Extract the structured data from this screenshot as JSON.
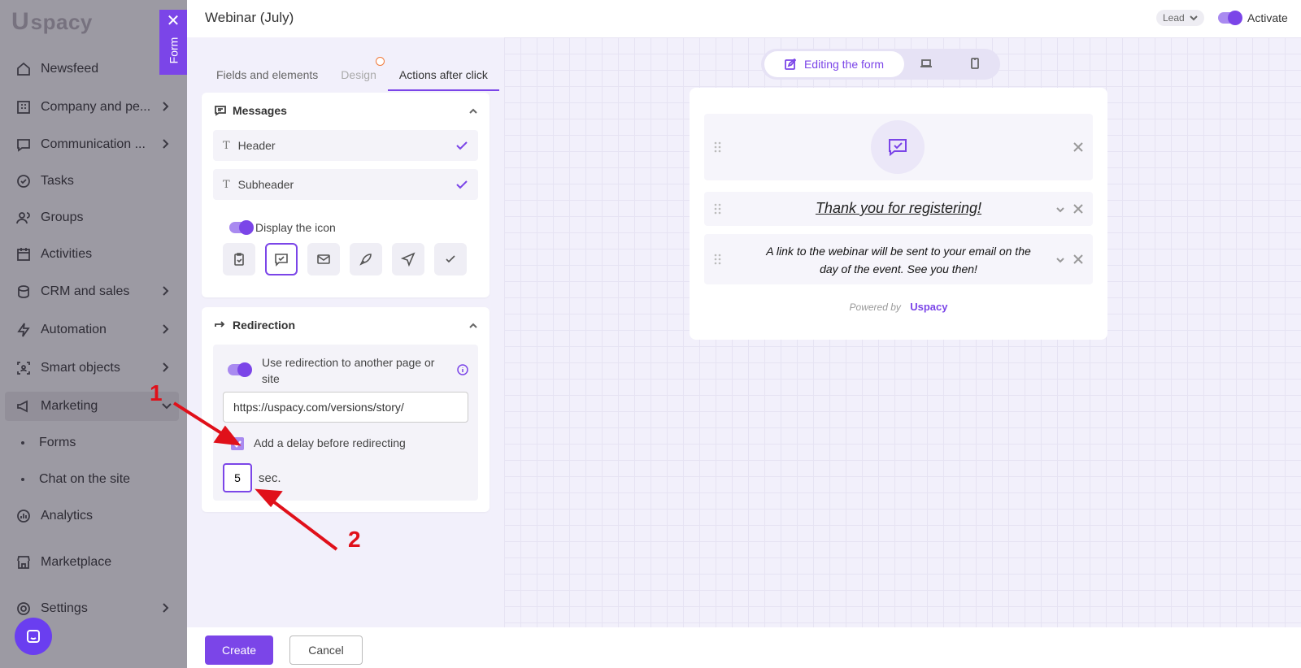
{
  "sidebar": {
    "logo_u": "U",
    "logo_rest": "spacy",
    "items": [
      {
        "label": "Newsfeed",
        "icon": "home-icon"
      },
      {
        "label": "Company and pe...",
        "icon": "building-icon"
      },
      {
        "label": "Communication ...",
        "icon": "chat-icon"
      },
      {
        "label": "Tasks",
        "icon": "check-circle-icon"
      },
      {
        "label": "Groups",
        "icon": "users-icon"
      },
      {
        "label": "Activities",
        "icon": "calendar-icon"
      },
      {
        "label": "CRM and sales",
        "icon": "coins-icon"
      },
      {
        "label": "Automation",
        "icon": "lightning-icon"
      },
      {
        "label": "Smart objects",
        "icon": "smart-object-icon"
      },
      {
        "label": "Marketing",
        "icon": "megaphone-icon"
      },
      {
        "label": "Analytics",
        "icon": "chart-icon"
      },
      {
        "label": "Marketplace",
        "icon": "store-icon"
      },
      {
        "label": "Settings",
        "icon": "gear-icon"
      }
    ],
    "sub_items": [
      "Forms",
      "Chat on the site"
    ]
  },
  "form_tab": {
    "close": "✕",
    "label": "Form"
  },
  "header": {
    "title": "Webinar (July)",
    "lead_label": "Lead",
    "activate_label": "Activate"
  },
  "tabs": [
    {
      "label": "Fields and elements"
    },
    {
      "label": "Design"
    },
    {
      "label": "Actions after click"
    }
  ],
  "messages": {
    "title": "Messages",
    "rows": [
      {
        "label": "Header"
      },
      {
        "label": "Subheader"
      }
    ],
    "display_icon_label": "Display the icon",
    "icons": [
      "clipboard-icon",
      "message-check-icon",
      "mail-icon",
      "rocket-icon",
      "send-icon",
      "check-icon"
    ]
  },
  "redirection": {
    "title": "Redirection",
    "use_label_1": "Use redirection to another page or",
    "use_label_2": "site",
    "url": "https://uspacy.com/versions/story/",
    "delay_label": "Add a delay before redirecting",
    "delay_value": "5",
    "delay_unit": "sec."
  },
  "preview": {
    "mode_label": "Editing the form",
    "thank_you": "Thank you for registering!",
    "sub_line_1": "A link to the webinar will be sent to your email on the",
    "sub_line_2": "day of the event. See you then!",
    "powered_by": "Powered by",
    "brand": "Uspacy"
  },
  "footer": {
    "create": "Create",
    "cancel": "Cancel"
  },
  "annotations": [
    "1",
    "2"
  ],
  "colors": {
    "accent": "#7b45e8",
    "annotation": "#e0101a"
  }
}
